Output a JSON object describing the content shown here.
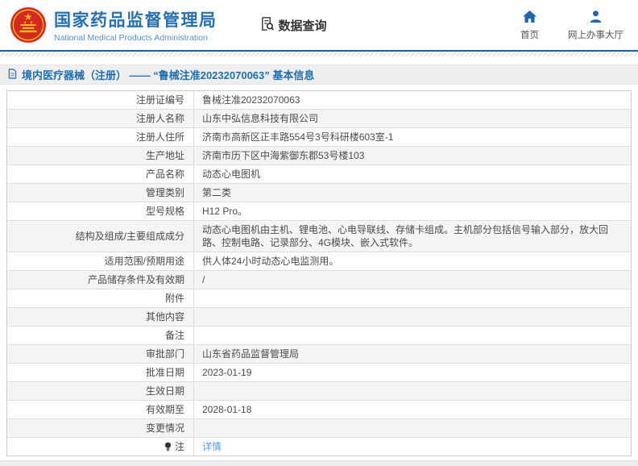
{
  "header": {
    "logo": {
      "title": "国家药品监督管理局",
      "subtitle": "National Medical Products Administration",
      "emblem": "china-national-emblem"
    },
    "section": {
      "label": "数据查询",
      "icon": "document-search-icon"
    },
    "nav": [
      {
        "label": "首页",
        "icon": "home-icon"
      },
      {
        "label": "网上办事大厅",
        "icon": "user-icon"
      }
    ]
  },
  "breadcrumb": {
    "icon": "document-icon",
    "text": "境内医疗器械（注册） —— “鲁械注准20232070063” 基本信息"
  },
  "table": {
    "rows": [
      {
        "label": "注册证编号",
        "value": "鲁械注准20232070063"
      },
      {
        "label": "注册人名称",
        "value": "山东中弘信息科技有限公司"
      },
      {
        "label": "注册人住所",
        "value": "济南市高新区正丰路554号3号科研楼603室-1"
      },
      {
        "label": "生产地址",
        "value": "济南市历下区中海紫御东郡53号楼103"
      },
      {
        "label": "产品名称",
        "value": "动态心电图机"
      },
      {
        "label": "管理类别",
        "value": "第二类"
      },
      {
        "label": "型号规格",
        "value": "H12 Pro。"
      },
      {
        "label": "结构及组成/主要组成成分",
        "value": "动态心电图机由主机、锂电池、心电导联线、存储卡组成。主机部分包括信号输入部分，放大回路、控制电路、记录部分、4G模块、嵌入式软件。"
      },
      {
        "label": "适用范围/预期用途",
        "value": "供人体24小时动态心电监测用。"
      },
      {
        "label": "产品储存条件及有效期",
        "value": "/"
      },
      {
        "label": "附件",
        "value": ""
      },
      {
        "label": "其他内容",
        "value": ""
      },
      {
        "label": "备注",
        "value": ""
      },
      {
        "label": "审批部门",
        "value": "山东省药品监督管理局"
      },
      {
        "label": "批准日期",
        "value": "2023-01-19"
      },
      {
        "label": "生效日期",
        "value": ""
      },
      {
        "label": "有效期至",
        "value": "2028-01-18"
      },
      {
        "label": "变更情况",
        "value": ""
      },
      {
        "label": "注",
        "label_icon": "lightbulb-icon",
        "value": "详情",
        "link": true
      }
    ]
  },
  "colors": {
    "brand_blue": "#2470b3",
    "nav_icon_blue": "#1f66b0",
    "breadcrumb_text_blue": "#1a6eb5",
    "link_blue": "#4d9df2",
    "header_rule_blue": "#1a5fa8",
    "alt_row_bg": "#f4f4f4",
    "emblem_red": "#d6281e",
    "emblem_gold": "#f5c21a"
  }
}
